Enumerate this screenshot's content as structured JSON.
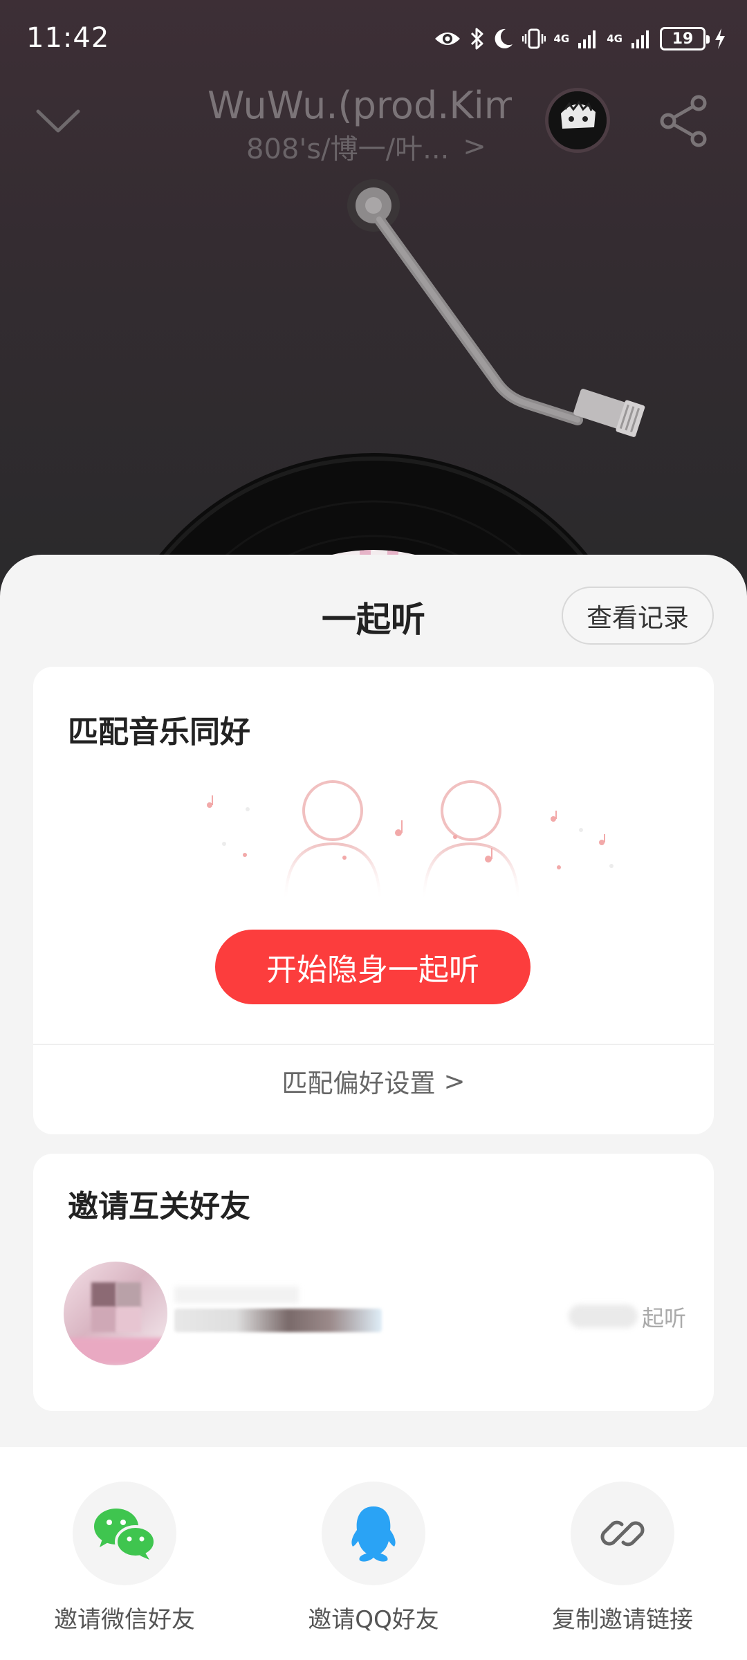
{
  "status_bar": {
    "time": "11:42",
    "network_1": "4G",
    "network_2": "4G",
    "battery": "19"
  },
  "player": {
    "song_title": "WuWu.(prod.Kim",
    "artist": "808's/博一/叶...",
    "artist_chevron": ">"
  },
  "listen_together": {
    "title": "一起听",
    "history_button": "查看记录",
    "match_card": {
      "title": "匹配音乐同好",
      "start_button": "开始隐身一起听",
      "preference_link": "匹配偏好设置",
      "preference_chevron": ">"
    },
    "invite_card": {
      "title": "邀请互关好友",
      "friend_action": "起听"
    }
  },
  "share_bar": {
    "items": [
      {
        "label": "邀请微信好友",
        "icon": "wechat-icon"
      },
      {
        "label": "邀请QQ好友",
        "icon": "qq-icon"
      },
      {
        "label": "复制邀请链接",
        "icon": "link-icon"
      }
    ]
  },
  "colors": {
    "accent": "#fc3d3d",
    "wechat": "#3fc54f",
    "qq": "#2aa3f5"
  }
}
